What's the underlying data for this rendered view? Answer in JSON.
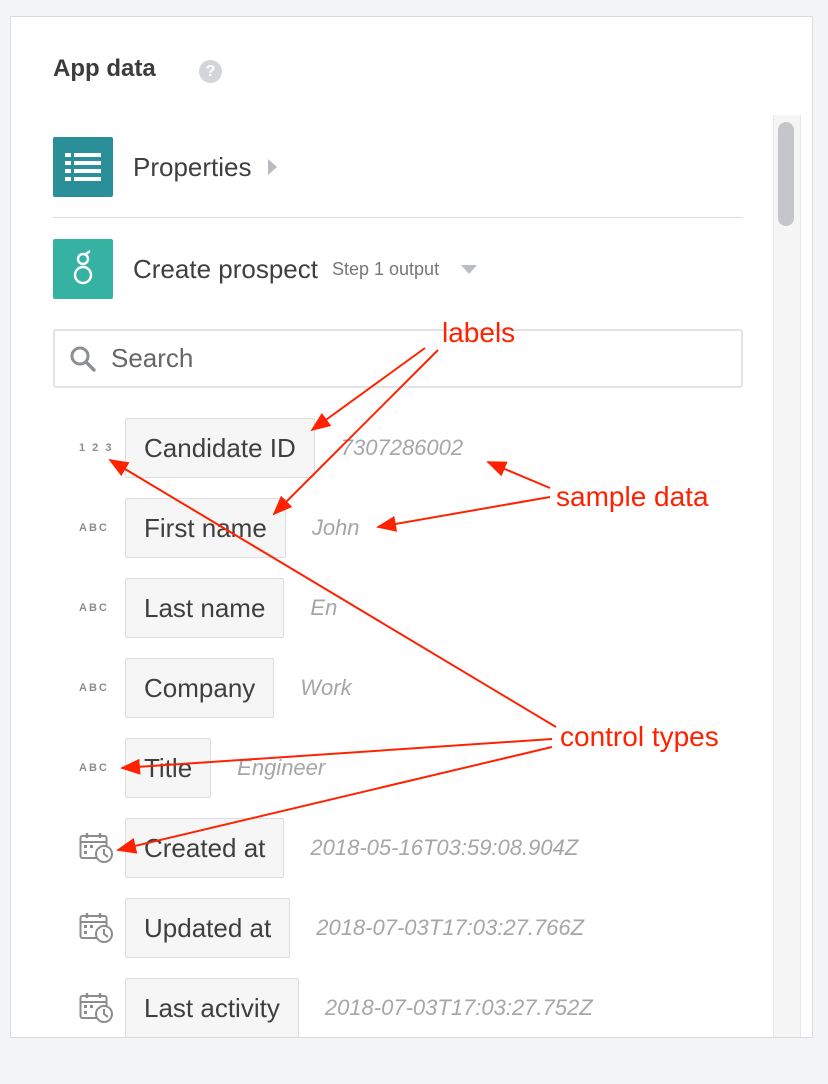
{
  "panel": {
    "title": "App data",
    "help_icon": "question-circle-icon"
  },
  "apps": [
    {
      "label": "Properties",
      "icon": "list-icon",
      "color": "#2a8f99"
    },
    {
      "label": "Create prospect",
      "step": "Step 1 output",
      "icon": "greenhouse-icon",
      "color": "#36b2a2"
    }
  ],
  "search": {
    "placeholder": "Search",
    "value": ""
  },
  "fields": [
    {
      "type": "1 2 3",
      "type_icon": "number-type-icon",
      "label": "Candidate ID",
      "sample": "7307286002"
    },
    {
      "type": "ABC",
      "type_icon": "text-type-icon",
      "label": "First name",
      "sample": "John"
    },
    {
      "type": "ABC",
      "type_icon": "text-type-icon",
      "label": "Last name",
      "sample": "En"
    },
    {
      "type": "ABC",
      "type_icon": "text-type-icon",
      "label": "Company",
      "sample": "Work"
    },
    {
      "type": "ABC",
      "type_icon": "text-type-icon",
      "label": "Title",
      "sample": "Engineer"
    },
    {
      "type": "",
      "type_icon": "datetime-type-icon",
      "label": "Created at",
      "sample": "2018-05-16T03:59:08.904Z"
    },
    {
      "type": "",
      "type_icon": "datetime-type-icon",
      "label": "Updated at",
      "sample": "2018-07-03T17:03:27.766Z"
    },
    {
      "type": "",
      "type_icon": "datetime-type-icon",
      "label": "Last activity",
      "sample": "2018-07-03T17:03:27.752Z"
    }
  ],
  "annotations": {
    "labels": "labels",
    "sample_data": "sample data",
    "control_types": "control types",
    "color": "#ff2200"
  }
}
